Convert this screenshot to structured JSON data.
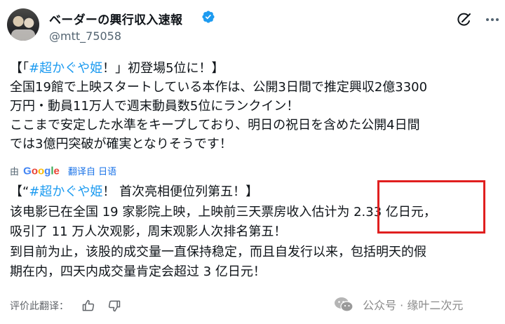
{
  "account": {
    "display_name": "ベーダーの興行収入速報",
    "handle": "@mtt_75058"
  },
  "tweet_ja": {
    "title_open": "【「",
    "title_hashtag": "#超かぐや姫",
    "title_rest": "！」初登場5位に！】",
    "lines": [
      "全国19館で上映スタートしている本作は、公開3日間で推定興収2億3300",
      "万円・動員11万人で週末動員数5位にランクイン！",
      "ここまで安定した水準をキープしており、明日の祝日を含めた公開4日間",
      "では3億円突破が確実となりそうです！"
    ]
  },
  "translation": {
    "by": "由",
    "google": [
      "G",
      "o",
      "o",
      "g",
      "l",
      "e"
    ],
    "link": "翻译自 日语"
  },
  "tweet_zh": {
    "title_open": "【“",
    "title_hashtag": "#超かぐや姫",
    "title_rest": "！ 首次亮相便位列第五！】",
    "lines": [
      "该电影已在全国 19 家影院上映，上映前三天票房收入估计为 2.33 亿日元，",
      "吸引了 11 万人次观影，周末观影人次排名第五！",
      "到目前为止，该股的成交量一直保持稳定，而且自发行以来，包括明天的假",
      "期在内，四天内成交量肯定会超过 3 亿日元！"
    ]
  },
  "footer": {
    "rate_label": "评价此翻译：",
    "watermark": "公众号 · 缘叶二次元"
  },
  "colors": {
    "hashtag": "#1d9bf0",
    "verified": "#1d9bf0",
    "highlight_border": "#e01f1f"
  },
  "icons": [
    "verified-badge-icon",
    "grok-icon",
    "more-icon",
    "thumbs-up-icon",
    "thumbs-down-icon",
    "wechat-icon"
  ]
}
